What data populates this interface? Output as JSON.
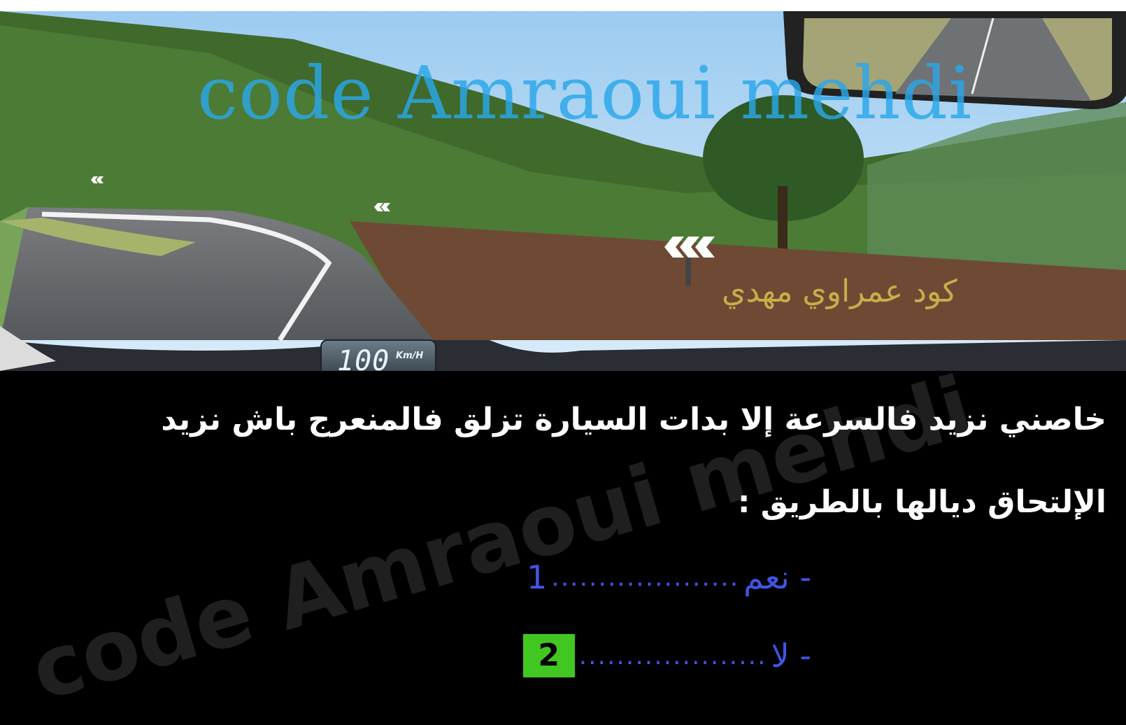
{
  "watermark": {
    "latin": "code Amraoui mehdi",
    "arabic": "كود عمراوي مهدي"
  },
  "speedometer": {
    "value": "100",
    "unit": "Km/H"
  },
  "question": {
    "line1": "خاصني نزيد فالسرعة إلا بدات السيارة تزلق فالمنعرج باش نزيد",
    "line2": "الإلتحاق ديالها بالطريق :"
  },
  "options": [
    {
      "label": "- نعم",
      "dots": "....................",
      "number": "1",
      "selected": false
    },
    {
      "label": "- لا",
      "dots": "....................",
      "number": "2",
      "selected": true
    }
  ],
  "colors": {
    "option_text": "#3f55e4",
    "selected_box": "#41c622",
    "panel_bg": "#000000"
  }
}
